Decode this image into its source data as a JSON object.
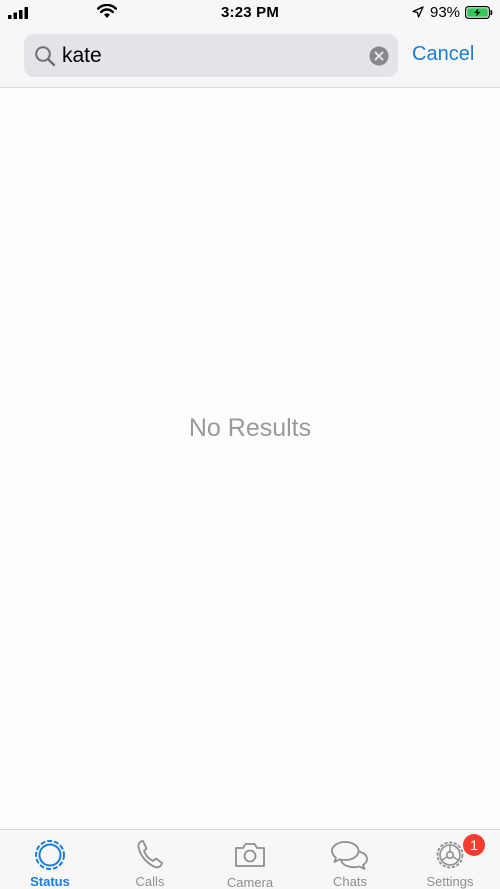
{
  "status_bar": {
    "time": "3:23 PM",
    "battery_percent": "93%",
    "icons": [
      "signal-icon",
      "wifi-icon",
      "location-icon",
      "battery-charging-icon"
    ]
  },
  "search": {
    "query": "kate",
    "cancel_label": "Cancel",
    "icons": [
      "search-icon",
      "clear-icon"
    ]
  },
  "results": {
    "empty_message": "No Results"
  },
  "tabs": [
    {
      "label": "Status",
      "icon": "status-icon",
      "active": true
    },
    {
      "label": "Calls",
      "icon": "phone-icon",
      "active": false
    },
    {
      "label": "Camera",
      "icon": "camera-icon",
      "active": false
    },
    {
      "label": "Chats",
      "icon": "chat-bubbles-icon",
      "active": false
    },
    {
      "label": "Settings",
      "icon": "gear-icon",
      "active": false,
      "badge": "1"
    }
  ],
  "colors": {
    "accent": "#1a7ed8",
    "badge": "#f53b30",
    "battery_fill": "#34c759",
    "muted_text": "#9a9a9a"
  }
}
